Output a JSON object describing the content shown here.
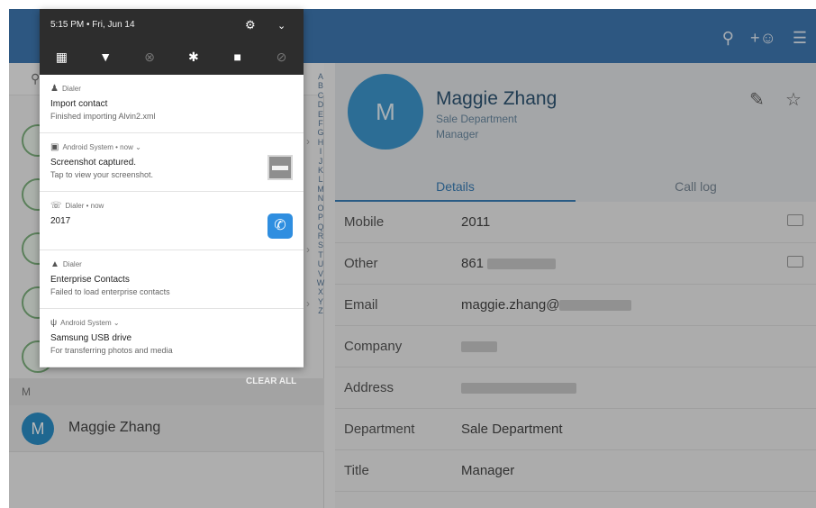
{
  "status_bar": {
    "time_date": "5:15 PM • Fri, Jun 14"
  },
  "quick_settings": {
    "icons": [
      "calendar-icon",
      "wifi-icon",
      "nfc-off-icon",
      "bluetooth-icon",
      "lock-icon",
      "sync-off-icon"
    ]
  },
  "notifications": [
    {
      "app": "Dialer",
      "time": "",
      "title": "Import contact",
      "text": "Finished importing Alvin2.xml"
    },
    {
      "app": "Android System • now ⌄",
      "time": "",
      "title": "Screenshot captured.",
      "text": "Tap to view your screenshot."
    },
    {
      "app": "Dialer • now",
      "time": "",
      "title": "2017",
      "text": ""
    },
    {
      "app": "Dialer",
      "time": "",
      "title": "Enterprise Contacts",
      "text": "Failed to load enterprise contacts"
    },
    {
      "app": "Android System ⌄",
      "time": "",
      "title": "Samsung USB drive",
      "text": "For transferring photos and media"
    }
  ],
  "clear_all_label": "CLEAR ALL",
  "contacts": {
    "section_letter": "M",
    "alphabet": [
      "A",
      "B",
      "C",
      "D",
      "E",
      "F",
      "G",
      "H",
      "I",
      "J",
      "K",
      "L",
      "M",
      "N",
      "O",
      "P",
      "Q",
      "R",
      "S",
      "T",
      "U",
      "V",
      "W",
      "X",
      "Y",
      "Z"
    ],
    "selected": {
      "initial": "M",
      "name": "Maggie Zhang"
    }
  },
  "detail": {
    "initial": "M",
    "name": "Maggie Zhang",
    "department": "Sale Department",
    "role": "Manager",
    "tabs": [
      "Details",
      "Call log"
    ],
    "fields": [
      {
        "label": "Mobile",
        "value": "2011"
      },
      {
        "label": "Other",
        "value": "861"
      },
      {
        "label": "Email",
        "value": "maggie.zhang@"
      },
      {
        "label": "Company",
        "value": ""
      },
      {
        "label": "Address",
        "value": ""
      },
      {
        "label": "Department",
        "value": "Sale Department"
      },
      {
        "label": "Title",
        "value": "Manager"
      }
    ]
  },
  "colors": {
    "topbar": "#3f79b3",
    "accent": "#3a7fb8",
    "avatar": "#3d98cf",
    "shade_top": "#2d2d2d"
  }
}
